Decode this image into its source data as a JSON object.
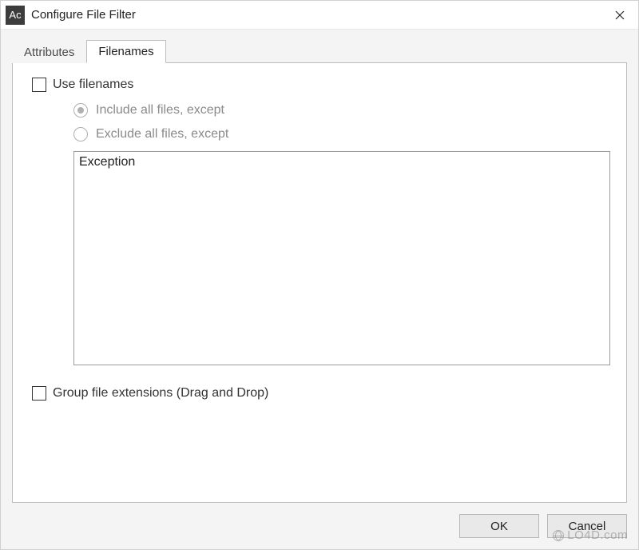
{
  "window": {
    "app_icon_text": "Ac",
    "title": "Configure File Filter"
  },
  "tabs": {
    "attributes": "Attributes",
    "filenames": "Filenames"
  },
  "panel": {
    "use_filenames_label": "Use filenames",
    "radio_include": "Include all files, except",
    "radio_exclude": "Exclude all files, except",
    "list_header": "Exception",
    "group_ext_label": "Group file extensions (Drag and Drop)"
  },
  "buttons": {
    "ok": "OK",
    "cancel": "Cancel"
  },
  "watermark": "LO4D.com"
}
